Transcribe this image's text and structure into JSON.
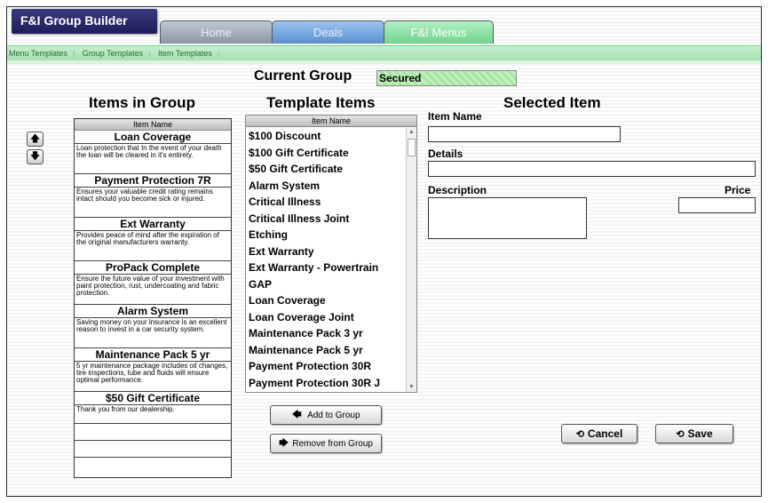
{
  "app": {
    "brand": "F&I Group Builder"
  },
  "tabs": [
    {
      "label": "Home"
    },
    {
      "label": "Deals"
    },
    {
      "label": "F&I Menus"
    }
  ],
  "subnav": [
    {
      "label": "Menu Templates"
    },
    {
      "label": "Group Templates"
    },
    {
      "label": "Item Templates"
    }
  ],
  "current_group": {
    "label": "Current Group",
    "value": "Secured"
  },
  "items_in_group": {
    "title": "Items in Group",
    "column_header": "Item Name",
    "items": [
      {
        "name": "Loan Coverage",
        "description": "Loan protection that In the event of your death the loan will be cleared in it's entirety."
      },
      {
        "name": "Payment Protection 7R",
        "description": "Ensures your valuable credit rating remains intact should you become sick or injured."
      },
      {
        "name": "Ext Warranty",
        "description": "Provides peace of mind after the expiration of the original manufacturers warranty."
      },
      {
        "name": "ProPack Complete",
        "description": "Ensure the future value of your investment with paint protection, rust, undercoating and fabric protection."
      },
      {
        "name": "Alarm System",
        "description": "Saving money on your insurance is an excellent reason to invest in a car security system."
      },
      {
        "name": "Maintenance Pack 5 yr",
        "description": "5 yr maintenance package includes oil changes, tire inspections, lube and fluids will ensure optimal performance."
      },
      {
        "name": "$50 Gift Certificate",
        "description": "Thank you from our dealership."
      }
    ]
  },
  "template_items": {
    "title": "Template Items",
    "column_header": "Item Name",
    "items": [
      "$100 Discount",
      "$100 Gift Certificate",
      "$50 Gift Certificate",
      "Alarm System",
      "Critical Illness",
      "Critical Illness Joint",
      "Etching",
      "Ext Warranty",
      "Ext Warranty - Powertrain",
      "GAP",
      "Loan Coverage",
      "Loan Coverage Joint",
      "Maintenance Pack 3 yr",
      "Maintenance Pack 5 yr",
      "Payment Protection 30R",
      "Payment Protection 30R J"
    ]
  },
  "buttons": {
    "add": "Add to Group",
    "remove": "Remove from Group",
    "cancel": "Cancel",
    "save": "Save"
  },
  "selected_item": {
    "title": "Selected Item",
    "item_name_label": "Item Name",
    "details_label": "Details",
    "description_label": "Description",
    "price_label": "Price",
    "item_name_value": "",
    "details_value": "",
    "description_value": "",
    "price_value": ""
  },
  "colors": {
    "brand_bg": "#1e1e5a",
    "tab_home": "#8c96a4",
    "tab_deals": "#5a90d0",
    "tab_fi": "#6ed48c",
    "current_group_bg": "#a7e6a1"
  }
}
